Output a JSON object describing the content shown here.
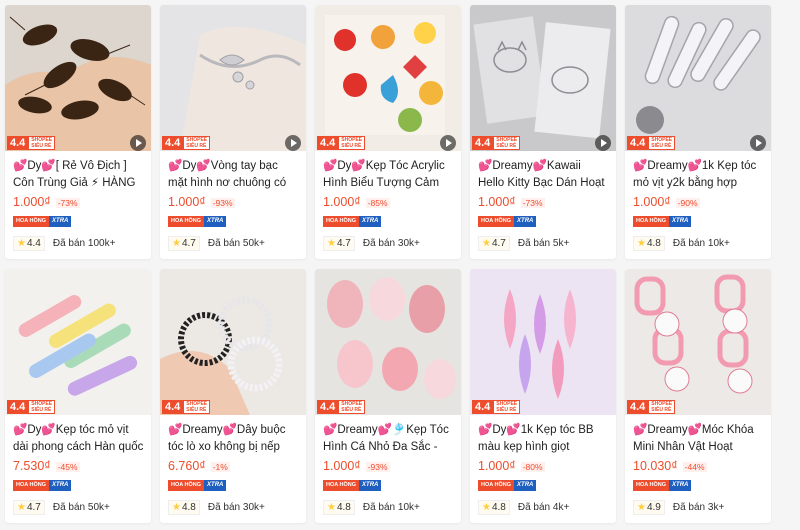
{
  "badge": {
    "score": "4.4",
    "line1": "SHOPEE",
    "line2": "SIÊU RẺ"
  },
  "tags": {
    "hoa_hong": "HOA HỒNG",
    "xtra": "XTRA"
  },
  "products": [
    {
      "title": "💕Dy💕[ Rẻ Vô Địch ] Côn Trùng Giả ⚡ HÀNG ĐẸP…",
      "price": "1.000₫",
      "discount": "-73%",
      "rating": "4.4",
      "sold": "Đã bán 100k+",
      "image": "cockroach-toys"
    },
    {
      "title": "💕Dy💕Vòng tay bạc mặt hình nơ chuông có thể đi…",
      "price": "1.000₫",
      "discount": "-93%",
      "rating": "4.7",
      "sold": "Đã bán 50k+",
      "image": "silver-bracelet"
    },
    {
      "title": "💕Dy💕Kẹp Tóc Acrylic Hình Biểu Tượng Cảm X…",
      "price": "1.000₫",
      "discount": "-85%",
      "rating": "4.7",
      "sold": "Đã bán 30k+",
      "image": "emoji-clips"
    },
    {
      "title": "💕Dreamy💕Kawaii Hello Kitty Bạc Dán Hoạt Hình…",
      "price": "1.000₫",
      "discount": "-73%",
      "rating": "4.7",
      "sold": "Đã bán 5k+",
      "image": "kitty-stickers"
    },
    {
      "title": "💕Dreamy💕1k Kẹp tóc mỏ vịt y2k bằng hợp kim…",
      "price": "1.000₫",
      "discount": "-90%",
      "rating": "4.8",
      "sold": "Đã bán 10k+",
      "image": "alloy-clips"
    },
    {
      "title": "💕Dy💕Kẹp tóc mỏ vịt dài phong cách Hàn quốc tối…",
      "price": "7.530₫",
      "discount": "-45%",
      "rating": "4.7",
      "sold": "Đã bán 50k+",
      "image": "pastel-clips"
    },
    {
      "title": "💕Dreamy💕Dây buộc tóc lò xo không bị nếp gấp g…",
      "price": "6.760₫",
      "discount": "-1%",
      "rating": "4.8",
      "sold": "Đã bán 30k+",
      "image": "coil-ties"
    },
    {
      "title": "💕Dreamy💕🎐Kẹp Tóc Hình Cá Nhỏ Đa Sắc - Ph…",
      "price": "1.000₫",
      "discount": "-93%",
      "rating": "4.8",
      "sold": "Đã bán 10k+",
      "image": "fish-clips"
    },
    {
      "title": "💕Dy💕1k Kẹp tóc BB màu kẹp hình giọt nước…",
      "price": "1.000₫",
      "discount": "-80%",
      "rating": "4.8",
      "sold": "Đã bán 4k+",
      "image": "bb-clips"
    },
    {
      "title": "💕Dreamy💕Móc Khóa Mini Nhân Vật Hoạt Hình…",
      "price": "10.030₫",
      "discount": "-44%",
      "rating": "4.9",
      "sold": "Đã bán 3k+",
      "image": "kitty-keychains"
    }
  ],
  "colors": {
    "accent": "#ee4d2d",
    "xtra": "#1f5fbf",
    "star": "#ffce3d"
  }
}
